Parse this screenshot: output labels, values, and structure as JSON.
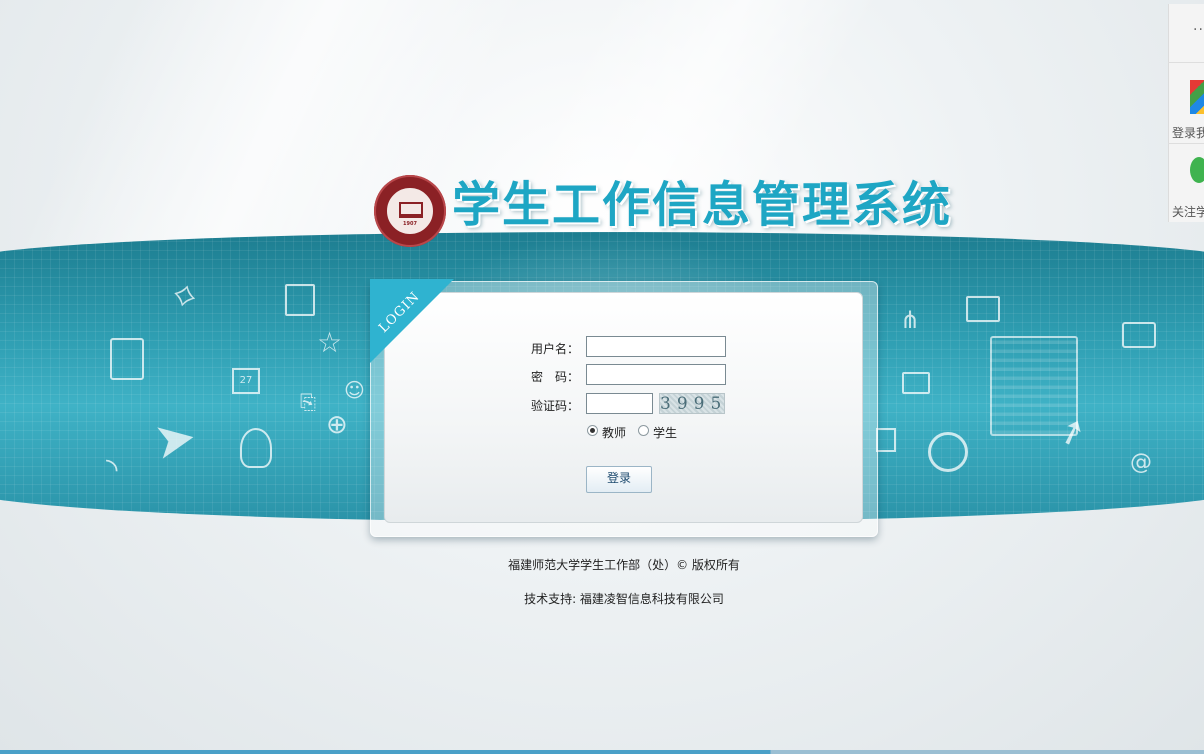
{
  "header": {
    "title": "学生工作信息管理系统",
    "seal_year": "1907"
  },
  "login": {
    "ribbon_text": "LOGIN",
    "username_label": "用户名：",
    "username_value": "",
    "password_label": "密　码：",
    "password_value": "",
    "captcha_label": "验证码：",
    "captcha_value": "",
    "captcha_text": "3995",
    "role_options": [
      {
        "label": "教师",
        "selected": true
      },
      {
        "label": "学生",
        "selected": false
      }
    ],
    "submit_label": "登录"
  },
  "footer": {
    "copyright": "福建师范大学学生工作部（处）© 版权所有",
    "support": "技术支持: 福建凌智信息科技有限公司"
  },
  "side_panel": {
    "more": "··",
    "item1_label": "登录我",
    "item2_label": "关注学"
  },
  "colors": {
    "accent": "#1ea6c4",
    "band": "#2e9db1",
    "seal": "#8b2125"
  }
}
